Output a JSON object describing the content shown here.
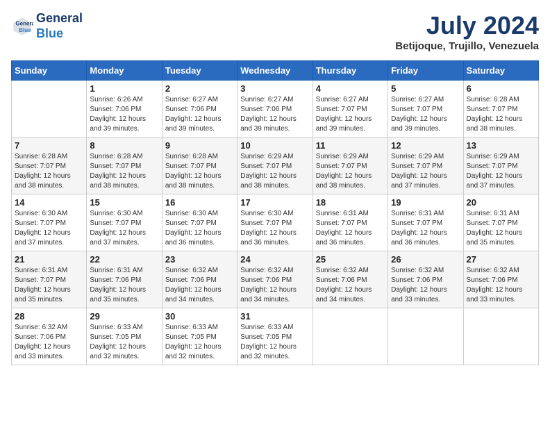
{
  "header": {
    "logo_line1": "General",
    "logo_line2": "Blue",
    "month_year": "July 2024",
    "location": "Betijoque, Trujillo, Venezuela"
  },
  "days_of_week": [
    "Sunday",
    "Monday",
    "Tuesday",
    "Wednesday",
    "Thursday",
    "Friday",
    "Saturday"
  ],
  "weeks": [
    [
      {
        "day": "",
        "sunrise": "",
        "sunset": "",
        "daylight": ""
      },
      {
        "day": "1",
        "sunrise": "Sunrise: 6:26 AM",
        "sunset": "Sunset: 7:06 PM",
        "daylight": "Daylight: 12 hours and 39 minutes."
      },
      {
        "day": "2",
        "sunrise": "Sunrise: 6:27 AM",
        "sunset": "Sunset: 7:06 PM",
        "daylight": "Daylight: 12 hours and 39 minutes."
      },
      {
        "day": "3",
        "sunrise": "Sunrise: 6:27 AM",
        "sunset": "Sunset: 7:06 PM",
        "daylight": "Daylight: 12 hours and 39 minutes."
      },
      {
        "day": "4",
        "sunrise": "Sunrise: 6:27 AM",
        "sunset": "Sunset: 7:07 PM",
        "daylight": "Daylight: 12 hours and 39 minutes."
      },
      {
        "day": "5",
        "sunrise": "Sunrise: 6:27 AM",
        "sunset": "Sunset: 7:07 PM",
        "daylight": "Daylight: 12 hours and 39 minutes."
      },
      {
        "day": "6",
        "sunrise": "Sunrise: 6:28 AM",
        "sunset": "Sunset: 7:07 PM",
        "daylight": "Daylight: 12 hours and 38 minutes."
      }
    ],
    [
      {
        "day": "7",
        "sunrise": "Sunrise: 6:28 AM",
        "sunset": "Sunset: 7:07 PM",
        "daylight": "Daylight: 12 hours and 38 minutes."
      },
      {
        "day": "8",
        "sunrise": "Sunrise: 6:28 AM",
        "sunset": "Sunset: 7:07 PM",
        "daylight": "Daylight: 12 hours and 38 minutes."
      },
      {
        "day": "9",
        "sunrise": "Sunrise: 6:28 AM",
        "sunset": "Sunset: 7:07 PM",
        "daylight": "Daylight: 12 hours and 38 minutes."
      },
      {
        "day": "10",
        "sunrise": "Sunrise: 6:29 AM",
        "sunset": "Sunset: 7:07 PM",
        "daylight": "Daylight: 12 hours and 38 minutes."
      },
      {
        "day": "11",
        "sunrise": "Sunrise: 6:29 AM",
        "sunset": "Sunset: 7:07 PM",
        "daylight": "Daylight: 12 hours and 38 minutes."
      },
      {
        "day": "12",
        "sunrise": "Sunrise: 6:29 AM",
        "sunset": "Sunset: 7:07 PM",
        "daylight": "Daylight: 12 hours and 37 minutes."
      },
      {
        "day": "13",
        "sunrise": "Sunrise: 6:29 AM",
        "sunset": "Sunset: 7:07 PM",
        "daylight": "Daylight: 12 hours and 37 minutes."
      }
    ],
    [
      {
        "day": "14",
        "sunrise": "Sunrise: 6:30 AM",
        "sunset": "Sunset: 7:07 PM",
        "daylight": "Daylight: 12 hours and 37 minutes."
      },
      {
        "day": "15",
        "sunrise": "Sunrise: 6:30 AM",
        "sunset": "Sunset: 7:07 PM",
        "daylight": "Daylight: 12 hours and 37 minutes."
      },
      {
        "day": "16",
        "sunrise": "Sunrise: 6:30 AM",
        "sunset": "Sunset: 7:07 PM",
        "daylight": "Daylight: 12 hours and 36 minutes."
      },
      {
        "day": "17",
        "sunrise": "Sunrise: 6:30 AM",
        "sunset": "Sunset: 7:07 PM",
        "daylight": "Daylight: 12 hours and 36 minutes."
      },
      {
        "day": "18",
        "sunrise": "Sunrise: 6:31 AM",
        "sunset": "Sunset: 7:07 PM",
        "daylight": "Daylight: 12 hours and 36 minutes."
      },
      {
        "day": "19",
        "sunrise": "Sunrise: 6:31 AM",
        "sunset": "Sunset: 7:07 PM",
        "daylight": "Daylight: 12 hours and 36 minutes."
      },
      {
        "day": "20",
        "sunrise": "Sunrise: 6:31 AM",
        "sunset": "Sunset: 7:07 PM",
        "daylight": "Daylight: 12 hours and 35 minutes."
      }
    ],
    [
      {
        "day": "21",
        "sunrise": "Sunrise: 6:31 AM",
        "sunset": "Sunset: 7:07 PM",
        "daylight": "Daylight: 12 hours and 35 minutes."
      },
      {
        "day": "22",
        "sunrise": "Sunrise: 6:31 AM",
        "sunset": "Sunset: 7:06 PM",
        "daylight": "Daylight: 12 hours and 35 minutes."
      },
      {
        "day": "23",
        "sunrise": "Sunrise: 6:32 AM",
        "sunset": "Sunset: 7:06 PM",
        "daylight": "Daylight: 12 hours and 34 minutes."
      },
      {
        "day": "24",
        "sunrise": "Sunrise: 6:32 AM",
        "sunset": "Sunset: 7:06 PM",
        "daylight": "Daylight: 12 hours and 34 minutes."
      },
      {
        "day": "25",
        "sunrise": "Sunrise: 6:32 AM",
        "sunset": "Sunset: 7:06 PM",
        "daylight": "Daylight: 12 hours and 34 minutes."
      },
      {
        "day": "26",
        "sunrise": "Sunrise: 6:32 AM",
        "sunset": "Sunset: 7:06 PM",
        "daylight": "Daylight: 12 hours and 33 minutes."
      },
      {
        "day": "27",
        "sunrise": "Sunrise: 6:32 AM",
        "sunset": "Sunset: 7:06 PM",
        "daylight": "Daylight: 12 hours and 33 minutes."
      }
    ],
    [
      {
        "day": "28",
        "sunrise": "Sunrise: 6:32 AM",
        "sunset": "Sunset: 7:06 PM",
        "daylight": "Daylight: 12 hours and 33 minutes."
      },
      {
        "day": "29",
        "sunrise": "Sunrise: 6:33 AM",
        "sunset": "Sunset: 7:05 PM",
        "daylight": "Daylight: 12 hours and 32 minutes."
      },
      {
        "day": "30",
        "sunrise": "Sunrise: 6:33 AM",
        "sunset": "Sunset: 7:05 PM",
        "daylight": "Daylight: 12 hours and 32 minutes."
      },
      {
        "day": "31",
        "sunrise": "Sunrise: 6:33 AM",
        "sunset": "Sunset: 7:05 PM",
        "daylight": "Daylight: 12 hours and 32 minutes."
      },
      {
        "day": "",
        "sunrise": "",
        "sunset": "",
        "daylight": ""
      },
      {
        "day": "",
        "sunrise": "",
        "sunset": "",
        "daylight": ""
      },
      {
        "day": "",
        "sunrise": "",
        "sunset": "",
        "daylight": ""
      }
    ]
  ]
}
